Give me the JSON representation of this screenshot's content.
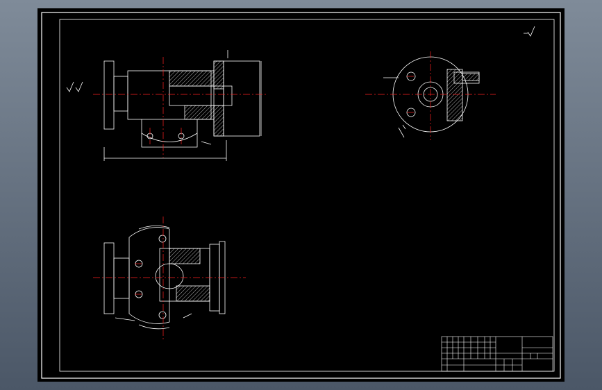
{
  "viewer": {
    "background": "#000000",
    "frame_color": "#ffffff",
    "centerline_color": "#ff2020",
    "dimension_color": "#ffffff",
    "hatch_color": "#ffffff"
  },
  "drawing": {
    "views": [
      "front-section-view",
      "side-view",
      "top-section-view"
    ],
    "roughness_symbols": 2
  },
  "title_block": {
    "title": "",
    "rows": 6,
    "columns": 10
  }
}
